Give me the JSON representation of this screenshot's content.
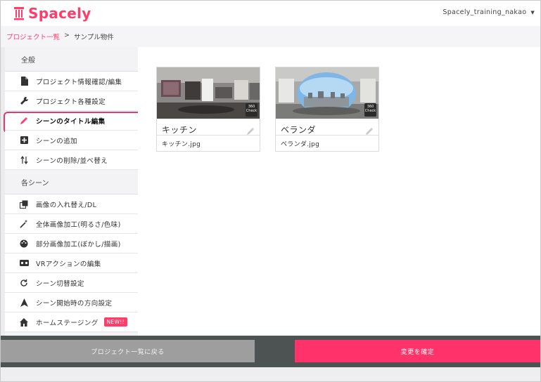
{
  "app": {
    "logo_text": "Spacely",
    "user_name": "Spacely_training_nakao",
    "brand_color": "#ff3d6b"
  },
  "breadcrumb": {
    "parent": "プロジェクト一覧",
    "separator": ">",
    "current": "サンプル物件"
  },
  "sidebar": {
    "section_general": "全般",
    "general_items": [
      {
        "label": "プロジェクト情報確認/編集",
        "icon": "document-icon"
      },
      {
        "label": "プロジェクト各種設定",
        "icon": "wrench-icon"
      },
      {
        "label": "シーンのタイトル編集",
        "icon": "pencil-icon",
        "active": true
      },
      {
        "label": "シーンの追加",
        "icon": "plus-box-icon"
      },
      {
        "label": "シーンの削除/並べ替え",
        "icon": "sort-arrows-icon"
      }
    ],
    "section_scenes": "各シーン",
    "scene_items": [
      {
        "label": "画像の入れ替え/DL",
        "icon": "image-swap-icon"
      },
      {
        "label": "全体画像加工(明るさ/色味)",
        "icon": "magic-wand-icon"
      },
      {
        "label": "部分画像加工(ぼかし/描画)",
        "icon": "palette-icon"
      },
      {
        "label": "VRアクションの編集",
        "icon": "vr-goggles-icon"
      },
      {
        "label": "シーン切替設定",
        "icon": "refresh-icon"
      },
      {
        "label": "シーン開始時の方向設定",
        "icon": "navigation-arrow-icon"
      },
      {
        "label": "ホームステージング",
        "icon": "home-icon",
        "badge": "NEW!!"
      }
    ]
  },
  "scenes": [
    {
      "title": "キッチン",
      "file": "キッチン.jpg",
      "badge_line1": "360",
      "badge_line2": "Check"
    },
    {
      "title": "ベランダ",
      "file": "ベランダ.jpg",
      "badge_line1": "360",
      "badge_line2": "Check"
    }
  ],
  "footer": {
    "back_label": "プロジェクト一覧に戻る",
    "confirm_label": "変更を確定"
  }
}
